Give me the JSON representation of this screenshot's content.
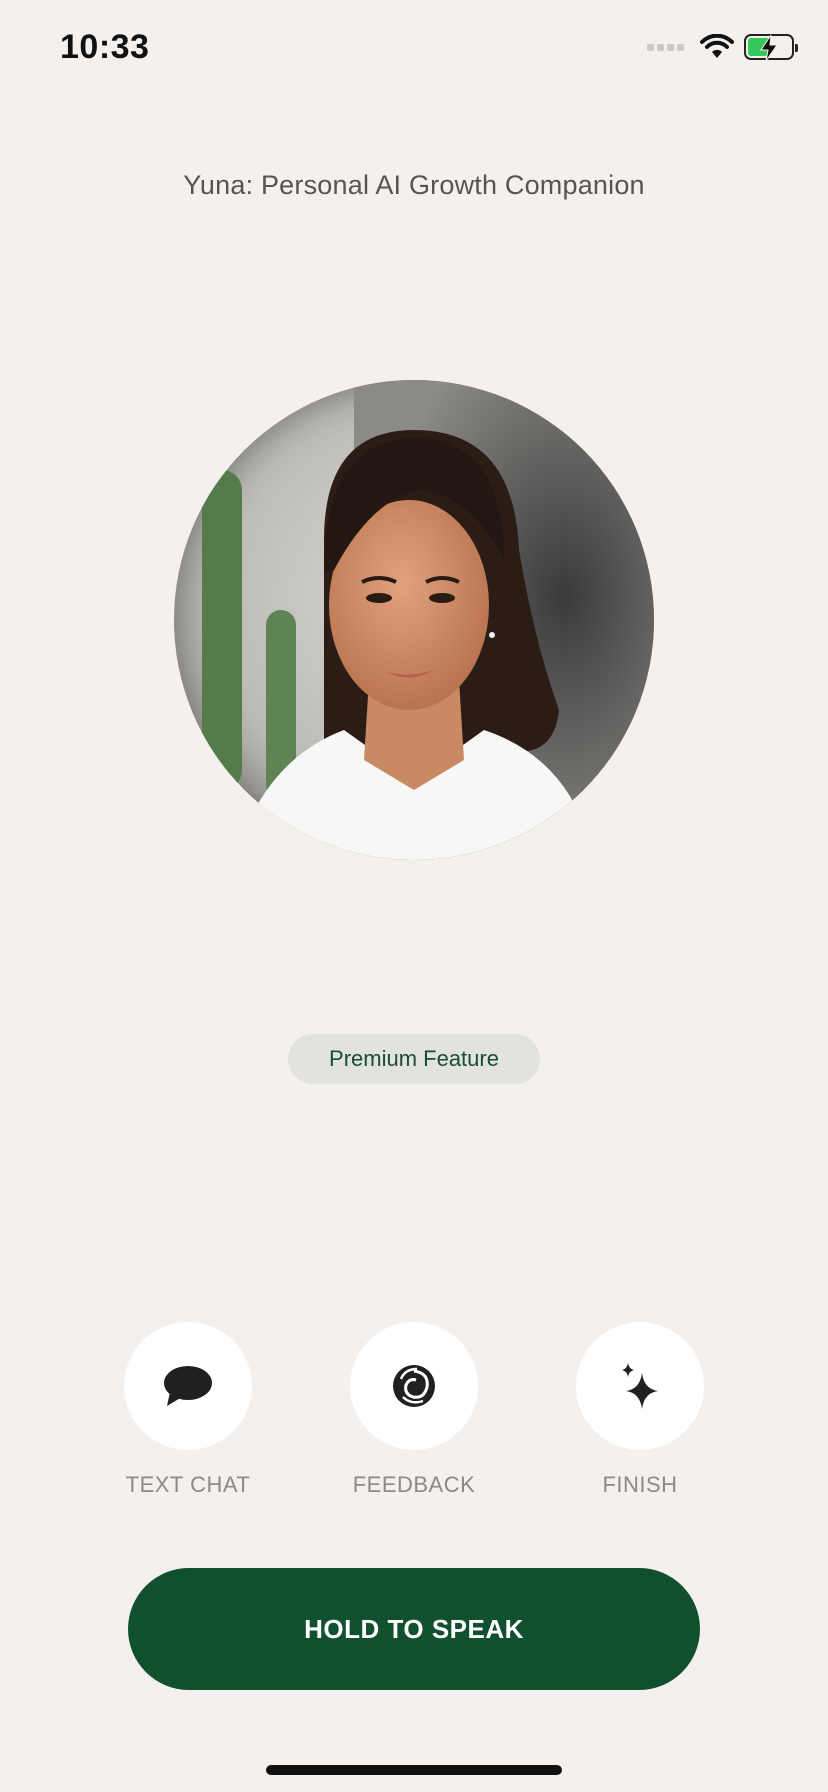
{
  "status_bar": {
    "time": "10:33",
    "icons": [
      "cellular-signal-icon",
      "wifi-icon",
      "battery-charging-icon"
    ]
  },
  "header": {
    "title": "Yuna: Personal AI Growth Companion"
  },
  "avatar": {
    "description_icon": "avatar-photo"
  },
  "badge": {
    "label": "Premium Feature"
  },
  "actions": [
    {
      "label": "TEXT CHAT",
      "icon": "chat-bubble-icon"
    },
    {
      "label": "FEEDBACK",
      "icon": "swirl-icon"
    },
    {
      "label": "FINISH",
      "icon": "sparkle-icon"
    }
  ],
  "primary_button": {
    "label": "HOLD TO SPEAK"
  },
  "colors": {
    "background": "#f3f0ed",
    "accent": "#10502f",
    "badge_bg": "#e2e3df",
    "badge_text": "#1a4d31",
    "label_gray": "#8a8a8a"
  }
}
